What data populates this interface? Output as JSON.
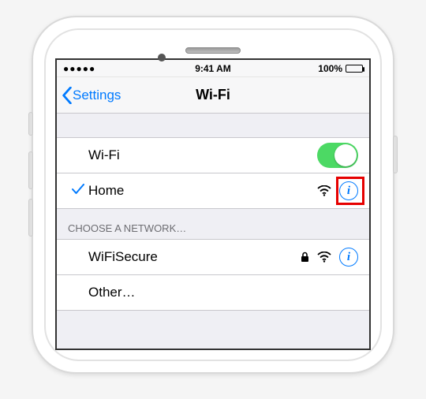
{
  "status": {
    "time": "9:41 AM",
    "battery_pct": "100%"
  },
  "nav": {
    "back": "Settings",
    "title": "Wi-Fi"
  },
  "wifi_row": {
    "label": "Wi-Fi",
    "on": true
  },
  "connected": {
    "name": "Home"
  },
  "section_header": "CHOOSE A NETWORK…",
  "networks": [
    {
      "name": "WiFiSecure",
      "locked": true
    },
    {
      "name": "Other…"
    }
  ]
}
